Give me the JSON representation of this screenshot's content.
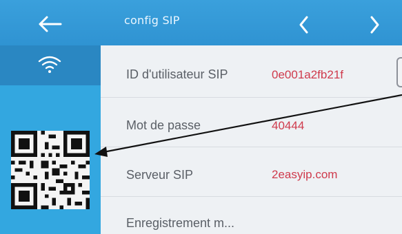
{
  "header": {
    "title": "config SIP",
    "back_icon": "arrow-left-icon",
    "prev_icon": "chevron-left-icon",
    "next_icon": "chevron-right-icon"
  },
  "sidebar": {
    "wifi_icon": "wifi-icon",
    "qr_code": "qr-code-image"
  },
  "sip_config": {
    "rows": [
      {
        "label": "ID d'utilisateur SIP",
        "value": "0e001a2fb21f"
      },
      {
        "label": "Mot de passe",
        "value": "40444"
      },
      {
        "label": "Serveur SIP",
        "value": "2easyip.com"
      },
      {
        "label": "Enregistrement m...",
        "value": ""
      }
    ]
  },
  "colors": {
    "header_blue": "#2f93d2",
    "sidebar_blue": "#33a7e0",
    "value_red": "#cf3a4c",
    "label_gray": "#5a5f66",
    "annotation_arrow": "#111111"
  }
}
